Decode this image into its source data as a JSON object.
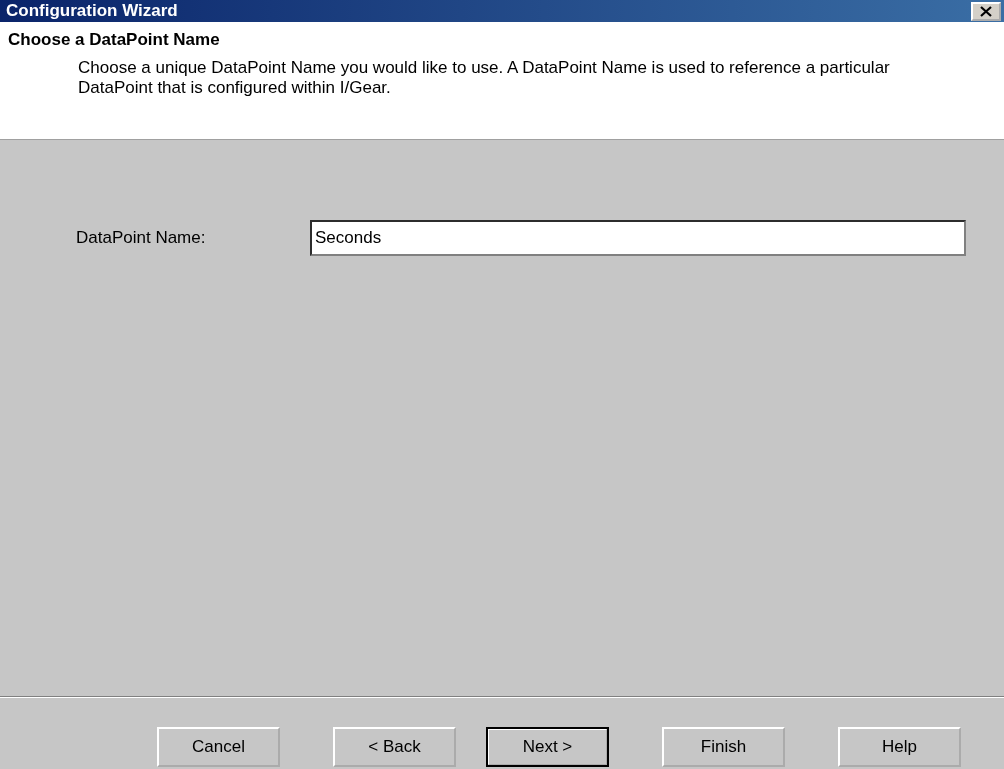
{
  "window": {
    "title": "Configuration Wizard"
  },
  "header": {
    "title": "Choose a DataPoint Name",
    "description": "Choose a unique DataPoint Name you would like to use.  A DataPoint Name is used to reference a particular DataPoint that is configured within I/Gear."
  },
  "form": {
    "label": "DataPoint Name:",
    "value": "Seconds"
  },
  "buttons": [
    {
      "label": "Cancel",
      "default": false
    },
    {
      "label": "< Back",
      "default": false
    },
    {
      "label": "Next >",
      "default": true
    },
    {
      "label": "Finish",
      "default": false
    },
    {
      "label": "Help",
      "default": false
    }
  ]
}
